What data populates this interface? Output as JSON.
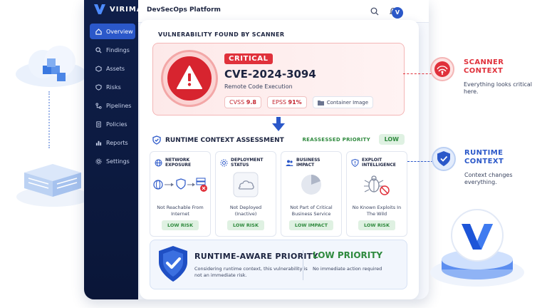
{
  "brand": {
    "name": "VIRIMA"
  },
  "app": {
    "title": "DevSecOps Platform",
    "avatar_initial": "V"
  },
  "sidebar": {
    "items": [
      {
        "label": "Overview",
        "icon": "home-icon",
        "active": true
      },
      {
        "label": "Findings",
        "icon": "search-icon"
      },
      {
        "label": "Assets",
        "icon": "box-icon"
      },
      {
        "label": "Risks",
        "icon": "shield-icon"
      },
      {
        "label": "Pipelines",
        "icon": "pipeline-icon"
      },
      {
        "label": "Policies",
        "icon": "document-icon"
      },
      {
        "label": "Reports",
        "icon": "bar-chart-icon"
      },
      {
        "label": "Settings",
        "icon": "gear-icon"
      }
    ]
  },
  "scanner": {
    "section_label": "VULNERABILITY FOUND BY SCANNER",
    "severity": "CRITICAL",
    "cve_id": "CVE-2024-3094",
    "description": "Remote Code Execution",
    "cvss_label": "CVSS",
    "cvss_value": "9.8",
    "epss_label": "EPSS",
    "epss_value": "91%",
    "asset_type": "Container Image"
  },
  "runtime": {
    "title": "RUNTIME CONTEXT ASSESSMENT",
    "reassessed_label": "REASSESSED PRIORITY",
    "reassessed_value": "LOW",
    "cards": [
      {
        "title": "NETWORK EXPOSURE",
        "desc": "Not Reachable From Internet",
        "tag": "LOW RISK"
      },
      {
        "title": "DEPLOYMENT STATUS",
        "desc": "Not Deployed (Inactive)",
        "tag": "LOW RISK"
      },
      {
        "title": "BUSINESS IMPACT",
        "desc": "Not Part of Critical Business Service",
        "tag": "LOW IMPACT"
      },
      {
        "title": "EXPLOIT INTELLIGENCE",
        "desc": "No Known Exploits In The Wild",
        "tag": "LOW RISK"
      }
    ]
  },
  "priority": {
    "title": "RUNTIME-AWARE PRIORITY",
    "subtitle": "Considering runtime context, this vulnerability is not an immediate risk.",
    "level": "LOW PRIORITY",
    "action": "No immediate action required"
  },
  "callouts": {
    "scanner": {
      "title": "SCANNER CONTEXT",
      "desc": "Everything looks critical here.",
      "color": "#e0313b"
    },
    "runtime": {
      "title": "RUNTIME CONTEXT",
      "desc": "Context changes everything.",
      "color": "#2b58c9"
    }
  }
}
